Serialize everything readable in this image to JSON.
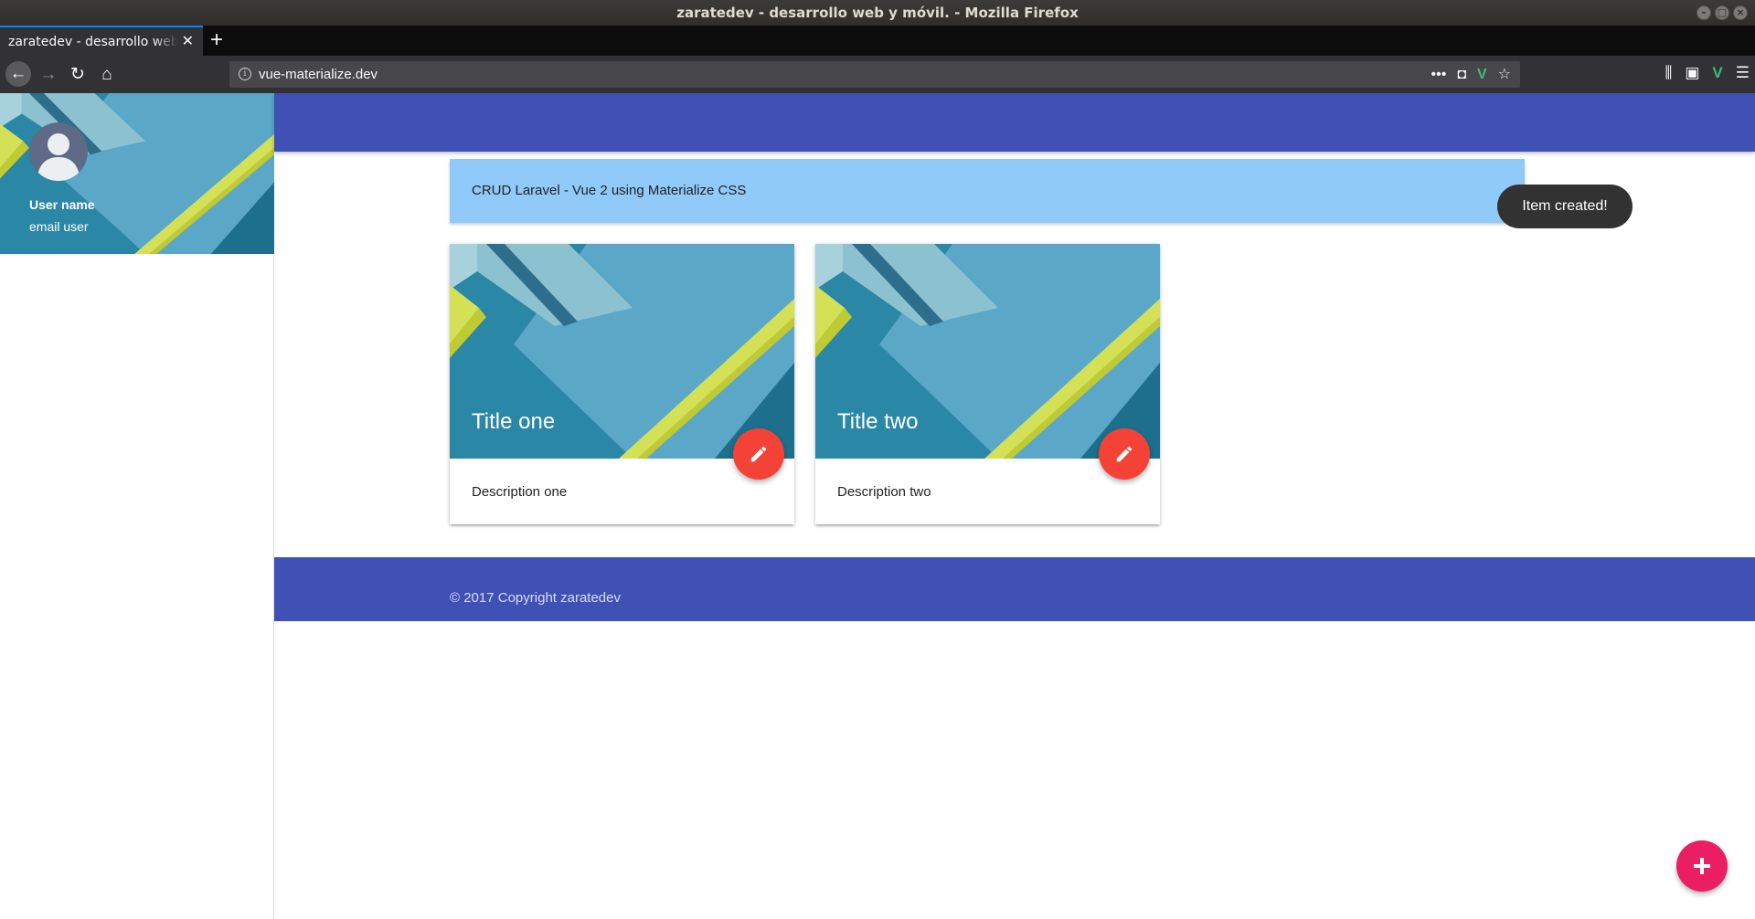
{
  "window": {
    "title": "zaratedev - desarrollo web y móvil. - Mozilla Firefox"
  },
  "browser": {
    "tab_title": "zaratedev - desarrollo web y móvil.",
    "url": "vue-materialize.dev",
    "icons": [
      "back-icon",
      "forward-icon",
      "reload-icon",
      "home-icon",
      "info-icon",
      "more-icon",
      "pocket-icon",
      "vue-devtools-icon",
      "bookmark-star-icon",
      "library-icon",
      "sidebar-icon",
      "menu-icon"
    ]
  },
  "sidenav": {
    "user_name": "User name",
    "user_email": "email user"
  },
  "banner": {
    "text": "CRUD Laravel - Vue 2 using Materialize CSS"
  },
  "cards": [
    {
      "title": "Title one",
      "description": "Description one"
    },
    {
      "title": "Title two",
      "description": "Description two"
    }
  ],
  "footer": {
    "copyright": "© 2017 Copyright zaratedev"
  },
  "toast": {
    "message": "Item created!"
  },
  "colors": {
    "primary": "#3f51b5",
    "banner": "#90caf9",
    "fab_edit": "#f44336",
    "fab_add": "#e91e63",
    "toast": "#323232"
  }
}
